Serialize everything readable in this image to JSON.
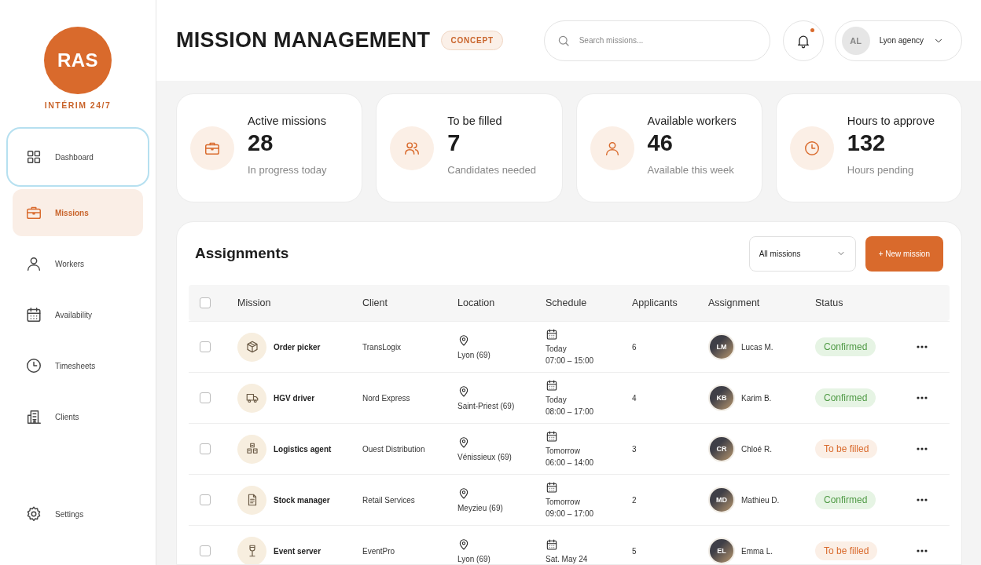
{
  "brand": {
    "logo": "RAS",
    "tagline": "INTÉRIM 24/7"
  },
  "sidebar": {
    "items": [
      {
        "label": "Dashboard",
        "selected": false,
        "focused": true
      },
      {
        "label": "Missions",
        "selected": true,
        "focused": false
      },
      {
        "label": "Workers",
        "selected": false,
        "focused": false
      },
      {
        "label": "Availability",
        "selected": false,
        "focused": false
      },
      {
        "label": "Timesheets",
        "selected": false,
        "focused": false
      },
      {
        "label": "Clients",
        "selected": false,
        "focused": false
      }
    ],
    "footer": {
      "label": "Settings",
      "selected": false,
      "focused": false
    }
  },
  "header": {
    "title": "MISSION MANAGEMENT",
    "badge": "CONCEPT",
    "search": {
      "placeholder": "Search missions..."
    },
    "notifications": {
      "unread": true
    },
    "account": {
      "initials": "AL",
      "name": "Lyon agency"
    }
  },
  "stats": [
    {
      "label": "Active missions",
      "value": "28",
      "note": "In progress today"
    },
    {
      "label": "To be filled",
      "value": "7",
      "note": "Candidates needed"
    },
    {
      "label": "Available workers",
      "value": "46",
      "note": "Available this week"
    },
    {
      "label": "Hours to approve",
      "value": "132",
      "note": "Hours pending"
    }
  ],
  "assignments": {
    "title": "Assignments",
    "all_checked": false,
    "filter": "All missions",
    "new_button": "+ New mission",
    "columns": [
      "Mission",
      "Client",
      "Location",
      "Schedule",
      "Applicants",
      "Assignment",
      "Status"
    ],
    "rows": [
      {
        "checked": false,
        "mission": "Order picker",
        "client": "TransLogix",
        "location": "Lyon (69)",
        "day": "Today",
        "hours": "07:00 – 15:00",
        "applicants": "6",
        "initials": "LM",
        "worker": "Lucas M.",
        "status": {
          "label": "Confirmed",
          "kind": "confirmed"
        }
      },
      {
        "checked": false,
        "mission": "HGV driver",
        "client": "Nord Express",
        "location": "Saint-Priest (69)",
        "day": "Today",
        "hours": "08:00 – 17:00",
        "applicants": "4",
        "initials": "KB",
        "worker": "Karim B.",
        "status": {
          "label": "Confirmed",
          "kind": "confirmed"
        }
      },
      {
        "checked": false,
        "mission": "Logistics agent",
        "client": "Ouest Distribution",
        "location": "Vénissieux (69)",
        "day": "Tomorrow",
        "hours": "06:00 – 14:00",
        "applicants": "3",
        "initials": "CR",
        "worker": "Chloé R.",
        "status": {
          "label": "To be filled",
          "kind": "open"
        }
      },
      {
        "checked": false,
        "mission": "Stock manager",
        "client": "Retail Services",
        "location": "Meyzieu (69)",
        "day": "Tomorrow",
        "hours": "09:00 – 17:00",
        "applicants": "2",
        "initials": "MD",
        "worker": "Mathieu D.",
        "status": {
          "label": "Confirmed",
          "kind": "confirmed"
        }
      },
      {
        "checked": false,
        "mission": "Event server",
        "client": "EventPro",
        "location": "Lyon (69)",
        "day": "Sat. May 24",
        "applicants": "5",
        "initials": "EL",
        "worker": "Emma L.",
        "status": {
          "label": "To be filled",
          "kind": "open"
        }
      }
    ]
  }
}
